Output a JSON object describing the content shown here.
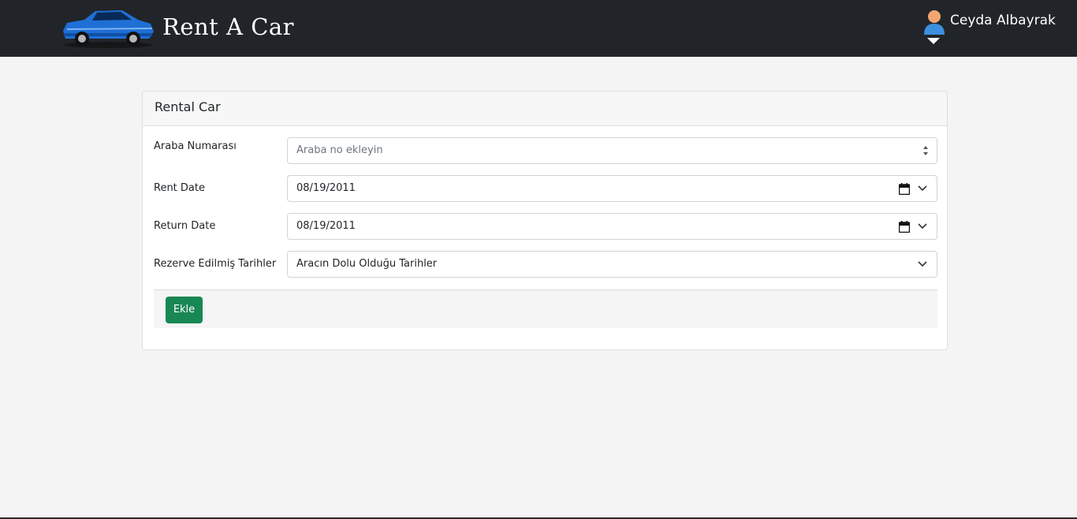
{
  "navbar": {
    "brand": "Rent A Car",
    "logo_icon": "blue-sports-car-logo",
    "user": {
      "name": "Ceyda Albayrak",
      "avatar_icon": "user-avatar-icon",
      "caret_icon": "caret-down-icon"
    }
  },
  "card": {
    "title": "Rental Car",
    "fields": {
      "car_number": {
        "label": "Araba Numarası",
        "value": "",
        "placeholder": "Araba no ekleyin"
      },
      "rent_date": {
        "label": "Rent Date",
        "value": "08/19/2011"
      },
      "return_date": {
        "label": "Return Date",
        "value": "08/19/2011"
      },
      "reserved_dates": {
        "label": "Rezerve Edilmiş Tarihler",
        "selected": "Aracın Dolu Olduğu Tarihler"
      }
    },
    "submit_label": "Ekle"
  },
  "colors": {
    "navbar_bg": "#212529",
    "page_bg": "#f4f4f4",
    "submit_button": "#198754",
    "logo_car": "#1f6fd6"
  }
}
